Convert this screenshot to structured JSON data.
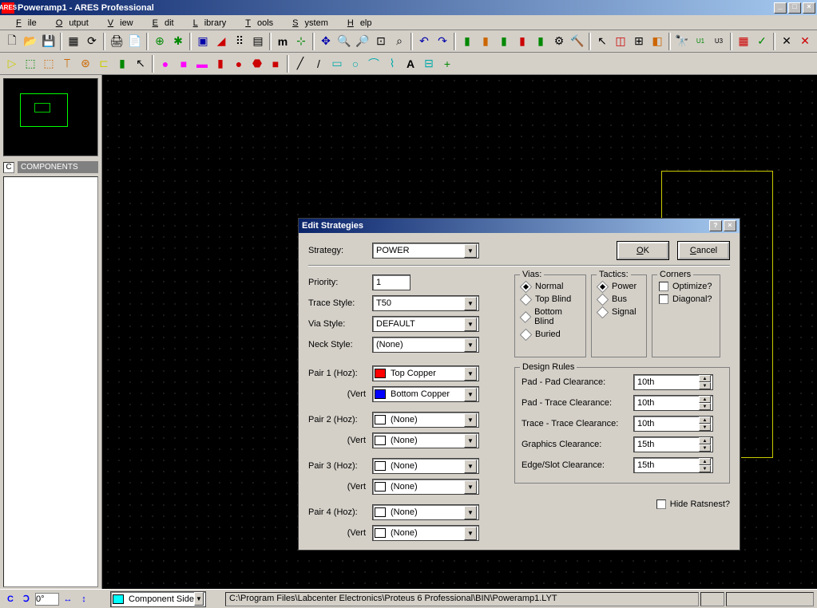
{
  "title": "Poweramp1 - ARES Professional",
  "menu": [
    "File",
    "Output",
    "View",
    "Edit",
    "Library",
    "Tools",
    "System",
    "Help"
  ],
  "components_label": "COMPONENTS",
  "components_letter": "C",
  "status": {
    "angle": "0°",
    "layer": "Component Side",
    "path": "C:\\Program Files\\Labcenter Electronics\\Proteus 6 Professional\\BIN\\Poweramp1.LYT"
  },
  "dialog": {
    "title": "Edit Strategies",
    "strategy_label": "Strategy:",
    "strategy": "POWER",
    "ok": "OK",
    "cancel": "Cancel",
    "priority_label": "Priority:",
    "priority": "1",
    "trace_style_label": "Trace Style:",
    "trace_style": "T50",
    "via_style_label": "Via Style:",
    "via_style": "DEFAULT",
    "neck_style_label": "Neck Style:",
    "neck_style": "(None)",
    "vias_title": "Vias:",
    "vias": [
      "Normal",
      "Top Blind",
      "Bottom Blind",
      "Buried"
    ],
    "tactics_title": "Tactics:",
    "tactics": [
      "Power",
      "Bus",
      "Signal"
    ],
    "corners_title": "Corners",
    "corners": [
      "Optimize?",
      "Diagonal?"
    ],
    "pairs": [
      {
        "h_label": "Pair 1 (Hoz):",
        "h_val": "Top Copper",
        "h_color": "#ff0000",
        "v_label": "(Vert",
        "v_val": "Bottom Copper",
        "v_color": "#0000ff"
      },
      {
        "h_label": "Pair 2 (Hoz):",
        "h_val": "(None)",
        "h_color": "#ffffff",
        "v_label": "(Vert",
        "v_val": "(None)",
        "v_color": "#ffffff"
      },
      {
        "h_label": "Pair 3 (Hoz):",
        "h_val": "(None)",
        "h_color": "#ffffff",
        "v_label": "(Vert",
        "v_val": "(None)",
        "v_color": "#ffffff"
      },
      {
        "h_label": "Pair 4 (Hoz):",
        "h_val": "(None)",
        "h_color": "#ffffff",
        "v_label": "(Vert",
        "v_val": "(None)",
        "v_color": "#ffffff"
      }
    ],
    "design_rules_title": "Design Rules",
    "rules": [
      {
        "label": "Pad - Pad Clearance:",
        "val": "10th"
      },
      {
        "label": "Pad - Trace Clearance:",
        "val": "10th"
      },
      {
        "label": "Trace - Trace Clearance:",
        "val": "10th"
      },
      {
        "label": "Graphics Clearance:",
        "val": "15th"
      },
      {
        "label": "Edge/Slot Clearance:",
        "val": "15th"
      }
    ],
    "hide_ratsnest": "Hide Ratsnest?"
  }
}
